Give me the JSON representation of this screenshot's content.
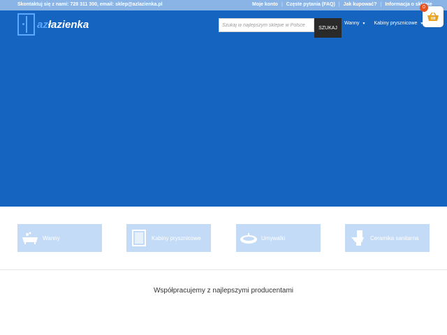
{
  "topbar": {
    "contact": "Skontaktuj się z nami: 728 311 300, email: sklep@azlazienka.pl",
    "links": [
      "Moje konto",
      "Częste pytania (FAQ)",
      "Jak kupować?",
      "Informacja o sklepie"
    ]
  },
  "header": {
    "logo_prefix": "az",
    "logo_suffix": "łazienka",
    "search_placeholder": "Szukaj w najlepszym sklepie w Polsce",
    "search_button": "SZUKAJ",
    "nav": [
      "Wanny",
      "Kabiny prysznicowe"
    ],
    "cart_count": "0"
  },
  "categories": [
    {
      "label": "Wanny",
      "icon": "bathtub-icon"
    },
    {
      "label": "Kabiny prysznicowe",
      "icon": "shower-cabin-icon"
    },
    {
      "label": "Umywalki",
      "icon": "sink-icon"
    },
    {
      "label": "Ceramika sanitarna",
      "icon": "toilet-icon"
    }
  ],
  "partners": {
    "heading": "Współpracujemy z najlepszymi producentami"
  },
  "colors": {
    "hero": "#1565c0",
    "topbar": "#8ab4e6",
    "category_tile": "#c4dbf7",
    "badge": "#e8501f"
  }
}
